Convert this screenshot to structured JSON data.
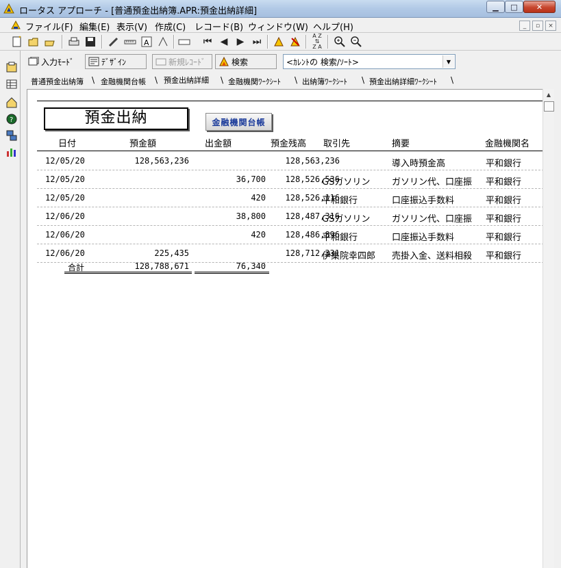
{
  "window": {
    "title": "ロータス アプローチ - [普通預金出納簿.APR:預金出納詳細]",
    "min_icon": "minimize-icon",
    "max_icon": "maximize-icon",
    "close_icon": "close-icon"
  },
  "menu": {
    "items": [
      "ファイル(F)",
      "編集(E)",
      "表示(V)",
      "作成(C)",
      "レコード(B)",
      "ウィンドウ(W)",
      "ヘルプ(H)"
    ]
  },
  "toolbar": {
    "icons": [
      "new-file-icon",
      "open-folder-icon",
      "open-icon",
      "print-icon",
      "save-icon",
      "edit-pencil-icon",
      "ruler-icon",
      "text-tool-icon",
      "draw-icon",
      "field-icon",
      "first-record-icon",
      "prev-record-icon",
      "next-record-icon",
      "last-record-icon",
      "find-icon",
      "find-all-icon",
      "sort-icon",
      "zoom-in-icon",
      "zoom-out-icon"
    ]
  },
  "toolbar2": {
    "input_mode": "入力ﾓｰﾄﾞ",
    "design": "ﾃﾞｻﾞｲﾝ",
    "new_record": "新規ﾚｺｰﾄﾞ",
    "search": "検索",
    "query_select": "<ｶﾚﾝﾄの 検索/ｿｰﾄ>"
  },
  "tabs": [
    "普通預金出納簿",
    "金融機関台帳",
    "預金出納詳細",
    "金融機関ﾜｰｸｼｰﾄ",
    "出納簿ﾜｰｸｼｰﾄ",
    "預金出納詳細ﾜｰｸｼｰﾄ"
  ],
  "active_tab_index": 2,
  "form": {
    "title": "預金出納",
    "bank_ledger_button": "金融機関台帳",
    "headers": {
      "date": "日付",
      "deposit": "預金額",
      "withdrawal": "出金額",
      "balance": "預金残高",
      "partner": "取引先",
      "summary": "摘要",
      "bank": "金融機関名"
    },
    "rows": [
      {
        "date": "12/05/20",
        "deposit": "128,563,236",
        "withdrawal": "",
        "balance": "128,563,236",
        "partner": "",
        "summary": "導入時預金高",
        "bank": "平和銀行"
      },
      {
        "date": "12/05/20",
        "deposit": "",
        "withdrawal": "36,700",
        "balance": "128,526,536",
        "partner": "GSガソリン",
        "summary": "ガソリン代、口座振",
        "bank": "平和銀行"
      },
      {
        "date": "12/05/20",
        "deposit": "",
        "withdrawal": "420",
        "balance": "128,526,116",
        "partner": "平和銀行",
        "summary": "口座振込手数料",
        "bank": "平和銀行"
      },
      {
        "date": "12/06/20",
        "deposit": "",
        "withdrawal": "38,800",
        "balance": "128,487,316",
        "partner": "GSガソリン",
        "summary": "ガソリン代、口座振",
        "bank": "平和銀行"
      },
      {
        "date": "12/06/20",
        "deposit": "",
        "withdrawal": "420",
        "balance": "128,486,896",
        "partner": "平和銀行",
        "summary": "口座振込手数料",
        "bank": "平和銀行"
      },
      {
        "date": "12/06/20",
        "deposit": "225,435",
        "withdrawal": "",
        "balance": "128,712,331",
        "partner": "伊集院幸四郎",
        "summary": "売掛入金、送料相殺",
        "bank": "平和銀行"
      }
    ],
    "totals": {
      "label": "合計",
      "deposit": "128,788,671",
      "withdrawal": "76,340"
    }
  },
  "colors": {
    "title_bar": "#b1c9e6",
    "close_button": "#c7472e",
    "link_button_text": "#1a3a9a"
  }
}
